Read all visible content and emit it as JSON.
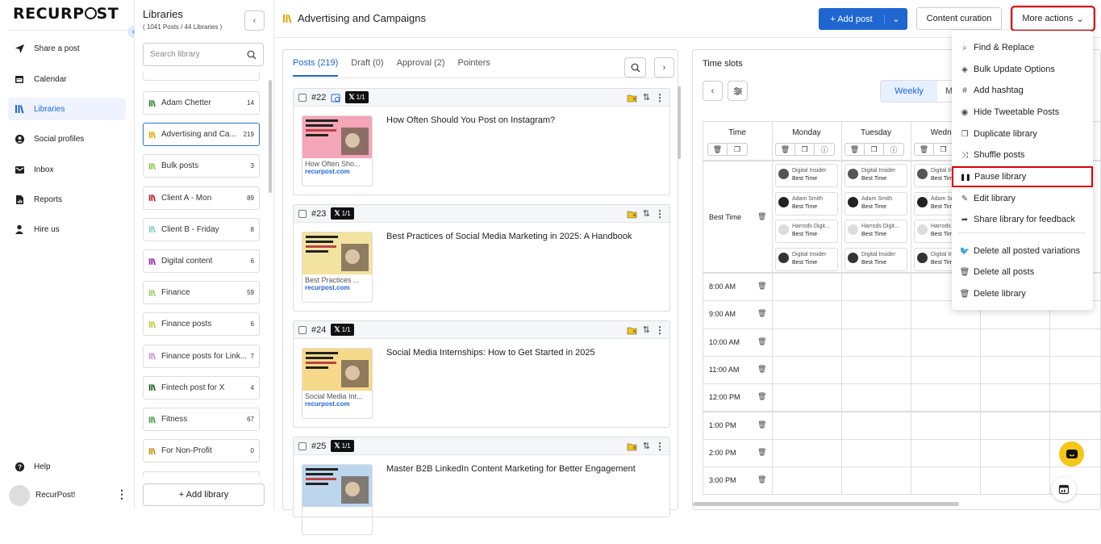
{
  "brand": "RECURPOST",
  "nav": {
    "items": [
      {
        "label": "Share a post",
        "icon": "send-icon"
      },
      {
        "label": "Calendar",
        "icon": "calendar-icon"
      },
      {
        "label": "Libraries",
        "icon": "libraries-icon",
        "active": true
      },
      {
        "label": "Social profiles",
        "icon": "user-circle-icon"
      },
      {
        "label": "Inbox",
        "icon": "inbox-icon"
      },
      {
        "label": "Reports",
        "icon": "reports-icon"
      },
      {
        "label": "Hire us",
        "icon": "person-icon"
      }
    ],
    "help": "Help",
    "account": "RecurPost!"
  },
  "libraries": {
    "title": "Libraries",
    "subtitle": "( 1041 Posts / 44 Libraries )",
    "search_placeholder": "Search library",
    "add_label": "+ Add library",
    "items": [
      {
        "name": "Adam Chetter",
        "count": "14",
        "color": "#2e7d32"
      },
      {
        "name": "Advertising and Ca...",
        "count": "219",
        "color": "#e0a800",
        "selected": true
      },
      {
        "name": "Bulk posts",
        "count": "3",
        "color": "#8bc34a"
      },
      {
        "name": "Client A - Mon",
        "count": "89",
        "color": "#b71c1c"
      },
      {
        "name": "Client B - Friday",
        "count": "8",
        "color": "#80cbc4"
      },
      {
        "name": "Digital content",
        "count": "6",
        "color": "#8e24aa"
      },
      {
        "name": "Finance",
        "count": "59",
        "color": "#9ccc65"
      },
      {
        "name": "Finance posts",
        "count": "6",
        "color": "#c0ca33"
      },
      {
        "name": "Finance posts for Link...",
        "count": "7",
        "color": "#ce93d8"
      },
      {
        "name": "Fintech post for X",
        "count": "4",
        "color": "#1b5e20"
      },
      {
        "name": "Fitness",
        "count": "67",
        "color": "#43a047"
      },
      {
        "name": "For Non-Profit",
        "count": "0",
        "color": "#c49000"
      }
    ]
  },
  "header": {
    "title": "Advertising and Campaigns",
    "add_post": "+ Add post",
    "content_curation": "Content curation",
    "more_actions": "More actions"
  },
  "posts": {
    "tabs": [
      "Posts (219)",
      "Draft (0)",
      "Approval (2)",
      "Pointers"
    ],
    "items": [
      {
        "num": "#22",
        "badge": "1/1",
        "title": "How Often Should You Post on Instagram?",
        "caption": "How Often Sho...",
        "domain": "recurpost.com",
        "img_color": "#f4a6b8"
      },
      {
        "num": "#23",
        "badge": "1/1",
        "title": "Best Practices of Social Media Marketing in 2025: A Handbook",
        "caption": "Best Practices ...",
        "domain": "recurpost.com",
        "img_color": "#f3e3a0"
      },
      {
        "num": "#24",
        "badge": "1/1",
        "title": "Social Media Internships: How to Get Started in 2025",
        "caption": "Social Media Int...",
        "domain": "recurpost.com",
        "img_color": "#f7d98b"
      },
      {
        "num": "#25",
        "badge": "1/1",
        "title": "Master B2B LinkedIn Content Marketing for Better Engagement",
        "caption": "",
        "domain": "",
        "img_color": "#bcd6ee"
      }
    ]
  },
  "timeslots": {
    "title": "Time slots",
    "view_weekly": "Weekly",
    "view_monthly_partial": "M",
    "col_time": "Time",
    "days": [
      "Monday",
      "Tuesday",
      "Wednes"
    ],
    "best_time": "Best Time",
    "chips": [
      {
        "name": "Digital Insider",
        "label": "Best Time"
      },
      {
        "name": "Adam Smith",
        "label": "Best Time"
      },
      {
        "name": "Harrods Digit...",
        "label": "Best Time"
      },
      {
        "name": "Digital Insider",
        "label": "Best Time"
      }
    ],
    "times": [
      "8:00 AM",
      "9:00 AM",
      "10:00 AM",
      "11:00 AM",
      "12:00 PM",
      "1:00 PM",
      "2:00 PM",
      "3:00 PM"
    ]
  },
  "more_menu": {
    "items": [
      {
        "label": "Find & Replace",
        "icon": "search-icon"
      },
      {
        "label": "Bulk Update Options",
        "icon": "layers-icon"
      },
      {
        "label": "Add hashtag",
        "icon": "hashtag-icon"
      },
      {
        "label": "Hide Tweetable Posts",
        "icon": "eye-icon"
      },
      {
        "label": "Duplicate library",
        "icon": "duplicate-icon"
      },
      {
        "label": "Shuffle posts",
        "icon": "shuffle-icon"
      },
      {
        "label": "Pause library",
        "icon": "pause-icon",
        "highlighted": true
      },
      {
        "label": "Edit library",
        "icon": "edit-icon"
      },
      {
        "label": "Share library for feedback",
        "icon": "share-icon"
      },
      {
        "label": "Delete all posted variations",
        "icon": "twitter-icon"
      },
      {
        "label": "Delete all posts",
        "icon": "trash-icon"
      },
      {
        "label": "Delete library",
        "icon": "trash-icon"
      }
    ]
  },
  "colors": {
    "accent": "#1f66d1",
    "highlight": "#e00000",
    "chat": "#f5c518"
  }
}
